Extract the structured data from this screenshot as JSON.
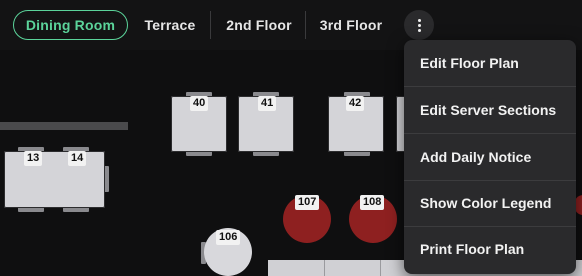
{
  "tabs": [
    {
      "label": "Dining Room",
      "active": true
    },
    {
      "label": "Terrace",
      "active": false
    },
    {
      "label": "2nd Floor",
      "active": false
    },
    {
      "label": "3rd Floor",
      "active": false
    }
  ],
  "more_button": {
    "icon": "kebab-vertical-icon"
  },
  "tables": [
    {
      "number": "40"
    },
    {
      "number": "41"
    },
    {
      "number": "42"
    },
    {
      "number": "13"
    },
    {
      "number": "14"
    },
    {
      "number": "107"
    },
    {
      "number": "108"
    },
    {
      "number": "106"
    }
  ],
  "menu": {
    "items": [
      {
        "label": "Edit Floor Plan"
      },
      {
        "label": "Edit Server Sections"
      },
      {
        "label": "Add Daily Notice"
      },
      {
        "label": "Show Color Legend"
      },
      {
        "label": "Print Floor Plan"
      }
    ]
  },
  "colors": {
    "accent": "#5bd39a",
    "background": "#0f0f10",
    "occupied_table": "#8e2020",
    "menu_bg": "#2a2a2c"
  }
}
